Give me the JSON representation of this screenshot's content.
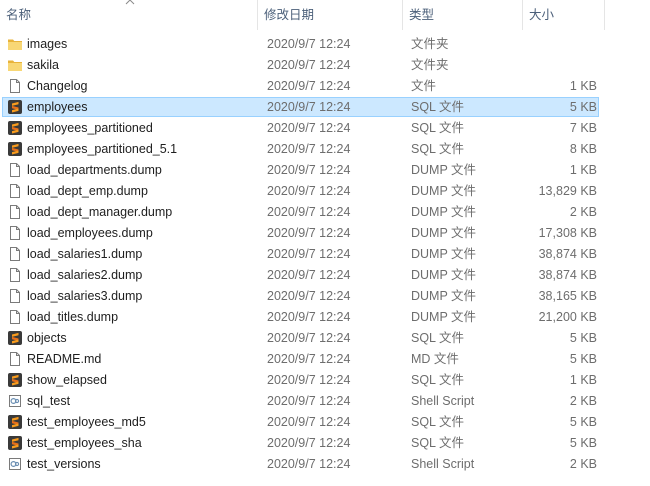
{
  "columns": {
    "name": "名称",
    "date": "修改日期",
    "type": "类型",
    "size": "大小"
  },
  "sort_icon": "chevron-up-icon",
  "colors": {
    "selection_bg": "#cce8ff",
    "selection_border": "#99d1ff",
    "folder": "#f8d775",
    "sql_icon": "#e8701a"
  },
  "files": [
    {
      "name": "images",
      "date": "2020/9/7 12:24",
      "type": "文件夹",
      "size": "",
      "icon": "folder-icon"
    },
    {
      "name": "sakila",
      "date": "2020/9/7 12:24",
      "type": "文件夹",
      "size": "",
      "icon": "folder-icon"
    },
    {
      "name": "Changelog",
      "date": "2020/9/7 12:24",
      "type": "文件",
      "size": "1 KB",
      "icon": "file-icon"
    },
    {
      "name": "employees",
      "date": "2020/9/7 12:24",
      "type": "SQL 文件",
      "size": "5 KB",
      "icon": "sql-file-icon",
      "selected": true
    },
    {
      "name": "employees_partitioned",
      "date": "2020/9/7 12:24",
      "type": "SQL 文件",
      "size": "7 KB",
      "icon": "sql-file-icon"
    },
    {
      "name": "employees_partitioned_5.1",
      "date": "2020/9/7 12:24",
      "type": "SQL 文件",
      "size": "8 KB",
      "icon": "sql-file-icon"
    },
    {
      "name": "load_departments.dump",
      "date": "2020/9/7 12:24",
      "type": "DUMP 文件",
      "size": "1 KB",
      "icon": "file-icon"
    },
    {
      "name": "load_dept_emp.dump",
      "date": "2020/9/7 12:24",
      "type": "DUMP 文件",
      "size": "13,829 KB",
      "icon": "file-icon"
    },
    {
      "name": "load_dept_manager.dump",
      "date": "2020/9/7 12:24",
      "type": "DUMP 文件",
      "size": "2 KB",
      "icon": "file-icon"
    },
    {
      "name": "load_employees.dump",
      "date": "2020/9/7 12:24",
      "type": "DUMP 文件",
      "size": "17,308 KB",
      "icon": "file-icon"
    },
    {
      "name": "load_salaries1.dump",
      "date": "2020/9/7 12:24",
      "type": "DUMP 文件",
      "size": "38,874 KB",
      "icon": "file-icon"
    },
    {
      "name": "load_salaries2.dump",
      "date": "2020/9/7 12:24",
      "type": "DUMP 文件",
      "size": "38,874 KB",
      "icon": "file-icon"
    },
    {
      "name": "load_salaries3.dump",
      "date": "2020/9/7 12:24",
      "type": "DUMP 文件",
      "size": "38,165 KB",
      "icon": "file-icon"
    },
    {
      "name": "load_titles.dump",
      "date": "2020/9/7 12:24",
      "type": "DUMP 文件",
      "size": "21,200 KB",
      "icon": "file-icon"
    },
    {
      "name": "objects",
      "date": "2020/9/7 12:24",
      "type": "SQL 文件",
      "size": "5 KB",
      "icon": "sql-file-icon"
    },
    {
      "name": "README.md",
      "date": "2020/9/7 12:24",
      "type": "MD 文件",
      "size": "5 KB",
      "icon": "file-icon"
    },
    {
      "name": "show_elapsed",
      "date": "2020/9/7 12:24",
      "type": "SQL 文件",
      "size": "1 KB",
      "icon": "sql-file-icon"
    },
    {
      "name": "sql_test",
      "date": "2020/9/7 12:24",
      "type": "Shell Script",
      "size": "2 KB",
      "icon": "shell-script-icon"
    },
    {
      "name": "test_employees_md5",
      "date": "2020/9/7 12:24",
      "type": "SQL 文件",
      "size": "5 KB",
      "icon": "sql-file-icon"
    },
    {
      "name": "test_employees_sha",
      "date": "2020/9/7 12:24",
      "type": "SQL 文件",
      "size": "5 KB",
      "icon": "sql-file-icon"
    },
    {
      "name": "test_versions",
      "date": "2020/9/7 12:24",
      "type": "Shell Script",
      "size": "2 KB",
      "icon": "shell-script-icon"
    }
  ]
}
